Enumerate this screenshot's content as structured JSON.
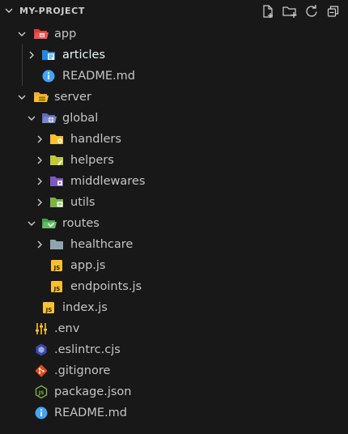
{
  "explorer": {
    "title": "MY-PROJECT",
    "actions": [
      {
        "name": "new-file-icon"
      },
      {
        "name": "new-folder-icon"
      },
      {
        "name": "refresh-icon"
      },
      {
        "name": "collapse-all-icon"
      }
    ]
  },
  "tree": [
    {
      "label": "app",
      "type": "folder",
      "open": true,
      "depth": 0,
      "icon": "folder-app-open-icon"
    },
    {
      "label": "articles",
      "type": "folder",
      "open": false,
      "depth": 1,
      "icon": "folder-blue-icon",
      "highlight": true
    },
    {
      "label": "README.md",
      "type": "file",
      "depth": 1,
      "icon": "info-icon"
    },
    {
      "label": "server",
      "type": "folder",
      "open": true,
      "depth": 0,
      "icon": "folder-server-open-icon"
    },
    {
      "label": "global",
      "type": "folder",
      "open": true,
      "depth": 1,
      "icon": "folder-global-open-icon"
    },
    {
      "label": "handlers",
      "type": "folder",
      "open": false,
      "depth": 2,
      "icon": "folder-handlers-icon"
    },
    {
      "label": "helpers",
      "type": "folder",
      "open": false,
      "depth": 2,
      "icon": "folder-helpers-icon"
    },
    {
      "label": "middlewares",
      "type": "folder",
      "open": false,
      "depth": 2,
      "icon": "folder-middlewares-icon"
    },
    {
      "label": "utils",
      "type": "folder",
      "open": false,
      "depth": 2,
      "icon": "folder-utils-icon"
    },
    {
      "label": "routes",
      "type": "folder",
      "open": true,
      "depth": 1,
      "icon": "folder-routes-open-icon"
    },
    {
      "label": "healthcare",
      "type": "folder",
      "open": false,
      "depth": 2,
      "icon": "folder-gray-icon"
    },
    {
      "label": "app.js",
      "type": "file",
      "depth": 2,
      "icon": "js-icon"
    },
    {
      "label": "endpoints.js",
      "type": "file",
      "depth": 2,
      "icon": "js-icon"
    },
    {
      "label": "index.js",
      "type": "file",
      "depth": 1,
      "icon": "js-icon"
    },
    {
      "label": ".env",
      "type": "file",
      "depth": 0,
      "icon": "settings-sliders-icon"
    },
    {
      "label": ".eslintrc.cjs",
      "type": "file",
      "depth": 0,
      "icon": "eslint-icon"
    },
    {
      "label": ".gitignore",
      "type": "file",
      "depth": 0,
      "icon": "git-icon"
    },
    {
      "label": "package.json",
      "type": "file",
      "depth": 0,
      "icon": "nodejs-icon"
    },
    {
      "label": "README.md",
      "type": "file",
      "depth": 0,
      "icon": "info-icon"
    }
  ]
}
